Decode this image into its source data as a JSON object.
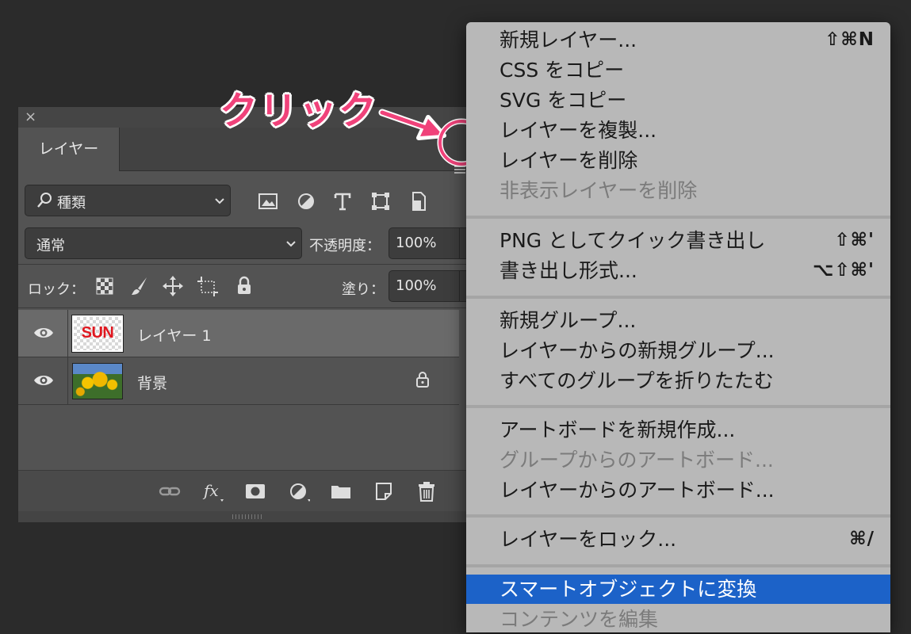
{
  "panel": {
    "close_glyph": "×",
    "tab_label": "レイヤー",
    "kind_filter": "種類",
    "blend_mode": "通常",
    "opacity_label": "不透明度：",
    "opacity_value": "100%",
    "lock_label": "ロック：",
    "fill_label": "塗り：",
    "fill_value": "100%",
    "layers": [
      {
        "name": "レイヤー 1",
        "thumb_text": "SUN",
        "selected": true
      },
      {
        "name": "背景",
        "locked": true,
        "selected": false
      }
    ],
    "filter_icons": [
      "image-filter-icon",
      "adjustment-filter-icon",
      "type-filter-icon",
      "shape-filter-icon",
      "smart-object-filter-icon"
    ],
    "lock_icons": [
      "lock-transparent-icon",
      "lock-image-icon",
      "lock-position-icon",
      "lock-artboard-icon",
      "lock-all-icon"
    ],
    "bottom_icons": [
      "link-icon",
      "fx-icon",
      "mask-icon",
      "adjustment-icon",
      "folder-icon",
      "new-layer-icon",
      "trash-icon"
    ]
  },
  "annotation": {
    "label": "クリック",
    "color": "#f0427a"
  },
  "menu": {
    "highlight_color": "#1c62c8",
    "items": [
      {
        "label": "新規レイヤー...",
        "shortcut": "⇧⌘N",
        "disabled": false
      },
      {
        "label": "CSS をコピー",
        "shortcut": "",
        "disabled": false
      },
      {
        "label": "SVG をコピー",
        "shortcut": "",
        "disabled": false
      },
      {
        "label": "レイヤーを複製...",
        "shortcut": "",
        "disabled": false
      },
      {
        "label": "レイヤーを削除",
        "shortcut": "",
        "disabled": false
      },
      {
        "label": "非表示レイヤーを削除",
        "shortcut": "",
        "disabled": true
      },
      {
        "label": "PNG としてクイック書き出し",
        "shortcut": "⇧⌘'",
        "disabled": false
      },
      {
        "label": "書き出し形式...",
        "shortcut": "⌥⇧⌘'",
        "disabled": false
      },
      {
        "label": "新規グループ...",
        "shortcut": "",
        "disabled": false
      },
      {
        "label": "レイヤーからの新規グループ...",
        "shortcut": "",
        "disabled": false
      },
      {
        "label": "すべてのグループを折りたたむ",
        "shortcut": "",
        "disabled": false
      },
      {
        "label": "アートボードを新規作成...",
        "shortcut": "",
        "disabled": false
      },
      {
        "label": "グループからのアートボード...",
        "shortcut": "",
        "disabled": true
      },
      {
        "label": "レイヤーからのアートボード...",
        "shortcut": "",
        "disabled": false
      },
      {
        "label": "レイヤーをロック...",
        "shortcut": "⌘/",
        "disabled": false
      },
      {
        "label": "スマートオブジェクトに変換",
        "shortcut": "",
        "disabled": false,
        "highlighted": true
      },
      {
        "label": "コンテンツを編集",
        "shortcut": "",
        "disabled": true
      }
    ]
  }
}
